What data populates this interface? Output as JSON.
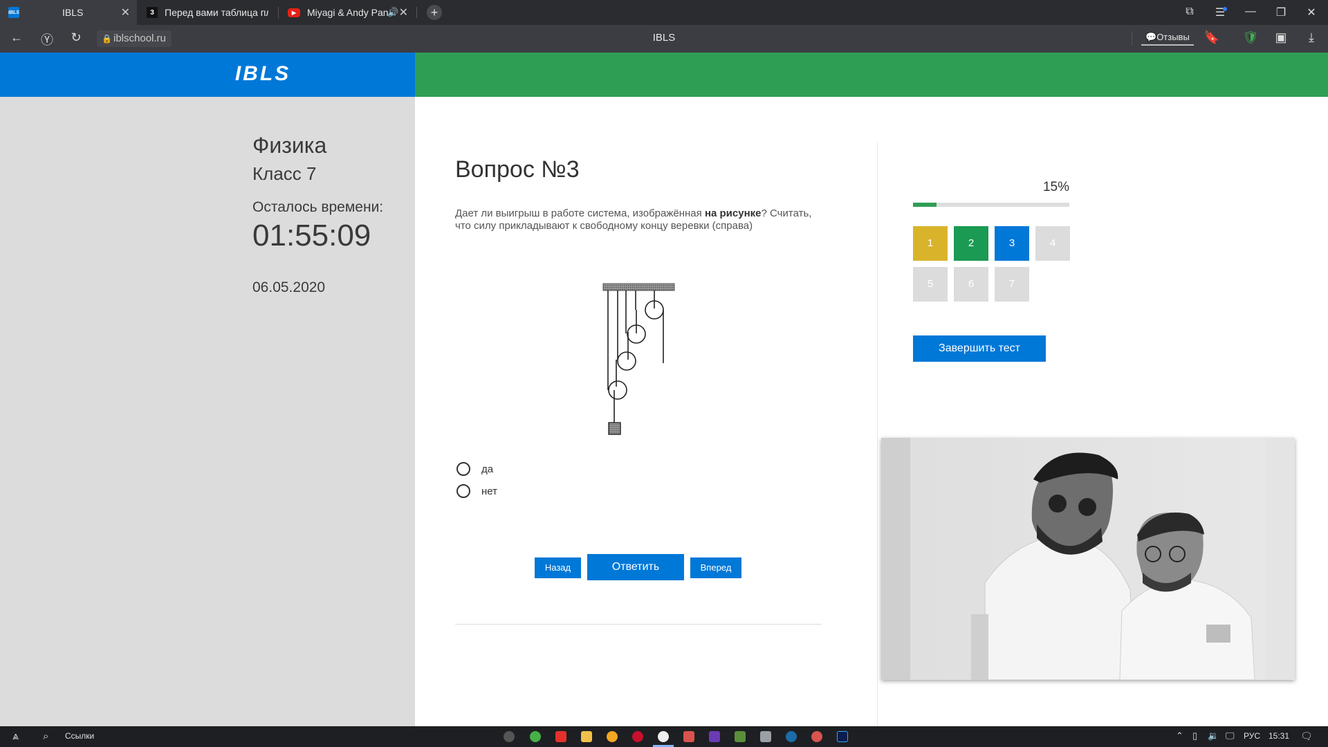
{
  "browser": {
    "tabs": [
      {
        "title": "IBLS",
        "favicon": "IBLS",
        "active": true
      },
      {
        "title": "Перед вами таблица пло",
        "favicon": "3",
        "active": false
      },
      {
        "title": "Miyagi & Andy Panc",
        "favicon": "youtube",
        "active": false
      }
    ],
    "url": "iblschool.ru",
    "page_title": "IBLS",
    "reviews_label": "Отзывы"
  },
  "header": {
    "logo": "IBLS",
    "left_color": "#0078d7",
    "right_color": "#2f9e55"
  },
  "sidebar": {
    "subject": "Физика",
    "grade": "Класс 7",
    "time_label": "Осталось времени:",
    "timer": "01:55:09",
    "date": "06.05.2020"
  },
  "question": {
    "title": "Вопрос №3",
    "text_before": "Дает ли выигрыш в работе система, изображённая ",
    "text_bold": "на рисунке",
    "text_after": "? Считать, что силу прикладывают к свободному концу веревки (справа)",
    "answers": [
      "да",
      "нет"
    ],
    "buttons": {
      "back": "Назад",
      "answer": "Ответить",
      "forward": "Вперед"
    }
  },
  "progress": {
    "percent_label": "15%",
    "percent": 15,
    "questions": [
      {
        "num": "1",
        "color": "#d9b42a"
      },
      {
        "num": "2",
        "color": "#1a9a52"
      },
      {
        "num": "3",
        "color": "#0078d7"
      },
      {
        "num": "4",
        "color": "#dcdcdc"
      },
      {
        "num": "5",
        "color": "#dcdcdc"
      },
      {
        "num": "6",
        "color": "#dcdcdc"
      },
      {
        "num": "7",
        "color": "#dcdcdc"
      }
    ],
    "finish_label": "Завершить тест"
  },
  "taskbar": {
    "search_label": "Ссылки",
    "lang": "РУС",
    "clock": "15:31"
  }
}
